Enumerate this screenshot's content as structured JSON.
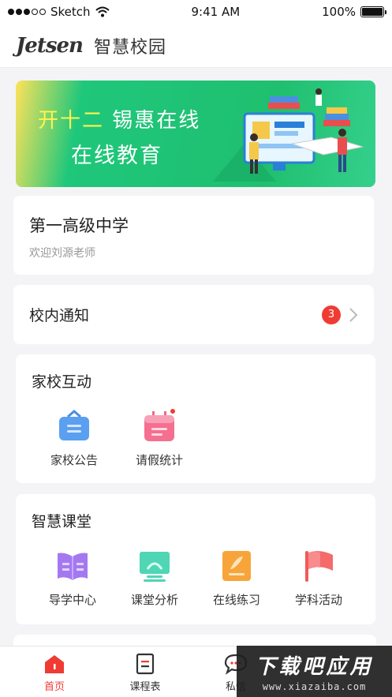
{
  "status_bar": {
    "carrier": "Sketch",
    "time": "9:41 AM",
    "battery": "100%"
  },
  "header": {
    "logo": "Jetsen",
    "title": "智慧校园"
  },
  "banner": {
    "line1_highlight": "开十二",
    "line1_rest": "锡惠在线",
    "line2": "在线教育"
  },
  "school": {
    "name": "第一高级中学",
    "welcome": "欢迎刘源老师"
  },
  "notice": {
    "title": "校内通知",
    "count": "3"
  },
  "home_school": {
    "title": "家校互动",
    "items": [
      {
        "label": "家校公告",
        "icon": "announcement-icon"
      },
      {
        "label": "请假统计",
        "icon": "calendar-icon"
      }
    ]
  },
  "smart_class": {
    "title": "智慧课堂",
    "items": [
      {
        "label": "导学中心",
        "icon": "book-icon"
      },
      {
        "label": "课堂分析",
        "icon": "monitor-icon"
      },
      {
        "label": "在线练习",
        "icon": "practice-icon"
      },
      {
        "label": "学科活动",
        "icon": "flag-icon"
      }
    ]
  },
  "tabbar": {
    "items": [
      {
        "label": "首页",
        "icon": "home-icon",
        "active": true
      },
      {
        "label": "课程表",
        "icon": "schedule-icon",
        "active": false
      },
      {
        "label": "私信",
        "icon": "message-icon",
        "active": false
      }
    ]
  },
  "watermark": {
    "title": "下载吧应用",
    "url": "www.xiazaiba.com"
  },
  "colors": {
    "accent": "#ef3b33",
    "banner_green": "#1fbf6f",
    "highlight_yellow": "#fff44f"
  }
}
